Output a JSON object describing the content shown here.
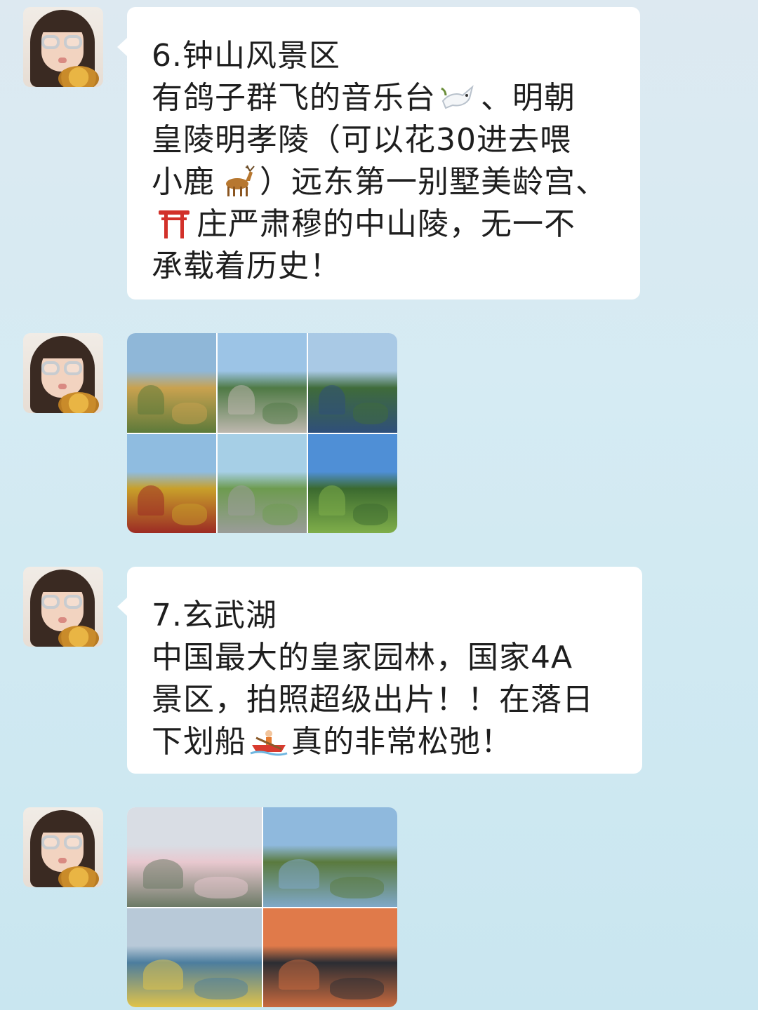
{
  "messages": [
    {
      "type": "text",
      "lines": [
        {
          "parts": [
            {
              "t": "6.钟山风景区"
            }
          ]
        },
        {
          "parts": [
            {
              "t": "有鸽子群飞的音乐台"
            },
            {
              "icon": "dove-icon"
            },
            {
              "t": "、明朝"
            }
          ]
        },
        {
          "parts": [
            {
              "t": "皇陵明孝陵（可以花30进去喂"
            }
          ]
        },
        {
          "parts": [
            {
              "t": "小鹿"
            },
            {
              "icon": "deer-icon"
            },
            {
              "t": "）远东第一别墅美龄宫、"
            }
          ]
        },
        {
          "parts": [
            {
              "icon": "torii-icon"
            },
            {
              "t": "庄严肃穆的中山陵，无一不"
            }
          ]
        },
        {
          "parts": [
            {
              "t": "承载着历史！"
            }
          ]
        }
      ]
    },
    {
      "type": "photo-grid",
      "cols": 3,
      "photos": [
        {
          "name": "meiling-palace-photo",
          "colors": [
            "#8fb7d8",
            "#c9a24f",
            "#5d7a3a"
          ]
        },
        {
          "name": "music-platform-doves-photo",
          "colors": [
            "#9cc4e6",
            "#4f7a45",
            "#bdb7ae"
          ]
        },
        {
          "name": "sun-yat-sen-mausoleum-photo",
          "colors": [
            "#a9c9e5",
            "#3f6b3a",
            "#2f4f7a"
          ]
        },
        {
          "name": "ming-tomb-red-wall-photo",
          "colors": [
            "#8fbce0",
            "#c8a02a",
            "#9c2b24"
          ]
        },
        {
          "name": "stone-elephants-path-photo",
          "colors": [
            "#a6cfe6",
            "#6d9b4f",
            "#9a9c99"
          ]
        },
        {
          "name": "deer-on-lawn-photo",
          "colors": [
            "#4f8fd6",
            "#3b6a2f",
            "#7fae4a"
          ]
        }
      ]
    },
    {
      "type": "text",
      "lines": [
        {
          "parts": [
            {
              "t": "7.玄武湖"
            }
          ]
        },
        {
          "parts": [
            {
              "t": "中国最大的皇家园林，国家4A"
            }
          ]
        },
        {
          "parts": [
            {
              "t": "景区，拍照超级出片！！在落日"
            }
          ]
        },
        {
          "parts": [
            {
              "t": "下划船"
            },
            {
              "icon": "rowboat-icon"
            },
            {
              "t": "真的非常松弛！"
            }
          ]
        }
      ]
    },
    {
      "type": "photo-grid",
      "cols": 2,
      "photos": [
        {
          "name": "cherry-blossom-lakeside-photo",
          "colors": [
            "#d9dde4",
            "#e8c8cf",
            "#6b7a66"
          ]
        },
        {
          "name": "willow-lake-photo",
          "colors": [
            "#8fb9dd",
            "#5a7a3e",
            "#7fa8c8"
          ]
        },
        {
          "name": "paddle-boats-photo",
          "colors": [
            "#b8c9d8",
            "#4c7d9e",
            "#e0c34a"
          ]
        },
        {
          "name": "sunset-skyline-photo",
          "colors": [
            "#e07a4a",
            "#2b2d33",
            "#c96a3e"
          ]
        }
      ]
    }
  ]
}
